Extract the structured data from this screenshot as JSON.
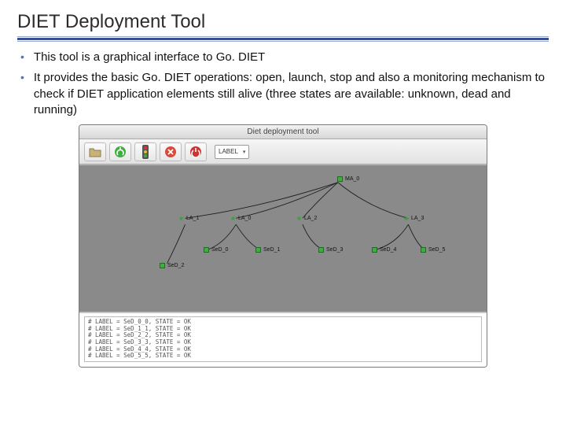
{
  "slide": {
    "title": "DIET Deployment Tool",
    "bullets": [
      "This tool is a graphical interface to Go. DIET",
      "It provides the basic Go. DIET operations: open, launch, stop and also a monitoring mechanism to check if DIET application elements still alive (three states are available: unknown, dead and running)"
    ]
  },
  "mockwin": {
    "title": "Diet deployment tool",
    "toolbar": {
      "combo_label": "LABEL"
    },
    "nodes": {
      "ma0": "MA_0",
      "la1": "LA_1",
      "la0": "LA_0",
      "la2": "LA_2",
      "la3": "LA_3",
      "sed0": "SeD_0",
      "sed1": "SeD_1",
      "sed2": "SeD_2",
      "sed3": "SeD_3",
      "sed4": "SeD_4",
      "sed5": "SeD_5"
    },
    "log": [
      "# LABEL = SeD_0_0, STATE = OK",
      "# LABEL = SeD_1_1, STATE = OK",
      "# LABEL = SeD_2_2, STATE = OK",
      "# LABEL = SeD_3_3, STATE = OK",
      "# LABEL = SeD_4_4, STATE = OK",
      "# LABEL = SeD_5_5, STATE = OK"
    ]
  }
}
